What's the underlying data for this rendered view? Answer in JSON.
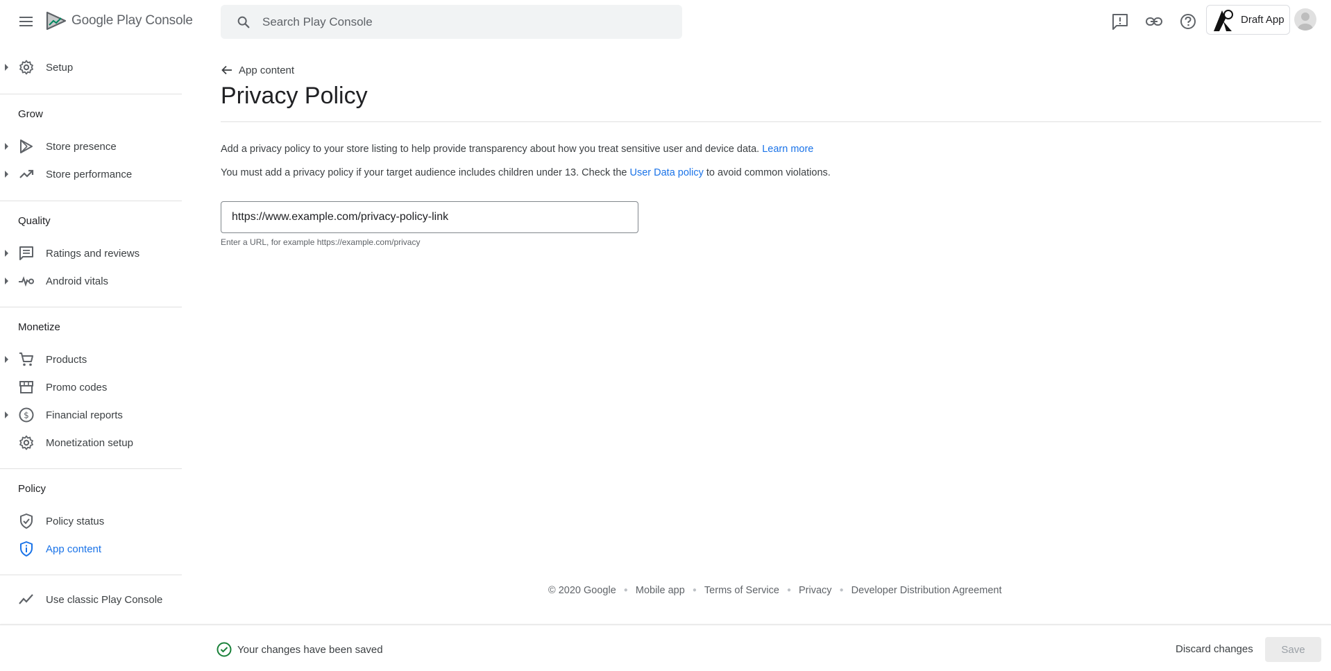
{
  "app": {
    "brand_google": "Google Play",
    "brand_console": "Console"
  },
  "search": {
    "placeholder": "Search Play Console"
  },
  "header": {
    "app_name": "Draft App"
  },
  "sidebar": {
    "items": [
      {
        "label": "Setup",
        "icon": "gear-icon",
        "expandable": true
      },
      {
        "section": "Grow"
      },
      {
        "label": "Store presence",
        "icon": "play-icon",
        "expandable": true
      },
      {
        "label": "Store performance",
        "icon": "trending-up-icon",
        "expandable": true
      },
      {
        "section": "Quality"
      },
      {
        "label": "Ratings and reviews",
        "icon": "reviews-icon",
        "expandable": true
      },
      {
        "label": "Android vitals",
        "icon": "vitals-icon",
        "expandable": true
      },
      {
        "section": "Monetize"
      },
      {
        "label": "Products",
        "icon": "cart-icon",
        "expandable": true
      },
      {
        "label": "Promo codes",
        "icon": "store-icon",
        "expandable": false
      },
      {
        "label": "Financial reports",
        "icon": "dollar-icon",
        "expandable": true
      },
      {
        "label": "Monetization setup",
        "icon": "gear-icon",
        "expandable": false
      },
      {
        "section": "Policy"
      },
      {
        "label": "Policy status",
        "icon": "shield-check-icon",
        "expandable": false
      },
      {
        "label": "App content",
        "icon": "shield-info-icon",
        "expandable": false,
        "active": true
      },
      {
        "label": "Use classic Play Console",
        "icon": "trending-icon",
        "expandable": false
      }
    ],
    "sections": {
      "grow": "Grow",
      "quality": "Quality",
      "monetize": "Monetize",
      "policy": "Policy"
    },
    "labels": {
      "setup": "Setup",
      "store_presence": "Store presence",
      "store_performance": "Store performance",
      "ratings": "Ratings and reviews",
      "vitals": "Android vitals",
      "products": "Products",
      "promo": "Promo codes",
      "financial": "Financial reports",
      "monetization_setup": "Monetization setup",
      "policy_status": "Policy status",
      "app_content": "App content",
      "classic": "Use classic Play Console"
    }
  },
  "main": {
    "back_label": "App content",
    "title": "Privacy Policy",
    "para1_text": "Add a privacy policy to your store listing to help provide transparency about how you treat sensitive user and device data.",
    "para1_link": "Learn more",
    "para2_before": "You must add a privacy policy if your target audience includes children under 13. Check the",
    "para2_link": "User Data policy",
    "para2_after": "to avoid common violations.",
    "url_value": "https://www.example.com/privacy-policy-link",
    "url_hint": "Enter a URL, for example https://example.com/privacy"
  },
  "footer": {
    "copyright": "© 2020 Google",
    "links": [
      "Mobile app",
      "Terms of Service",
      "Privacy",
      "Developer Distribution Agreement"
    ]
  },
  "bottombar": {
    "status": "Your changes have been saved",
    "discard_label": "Discard changes",
    "save_label": "Save"
  },
  "colors": {
    "accent": "#1a73e8",
    "success": "#188038",
    "text": "#202124",
    "muted": "#5f6368"
  }
}
